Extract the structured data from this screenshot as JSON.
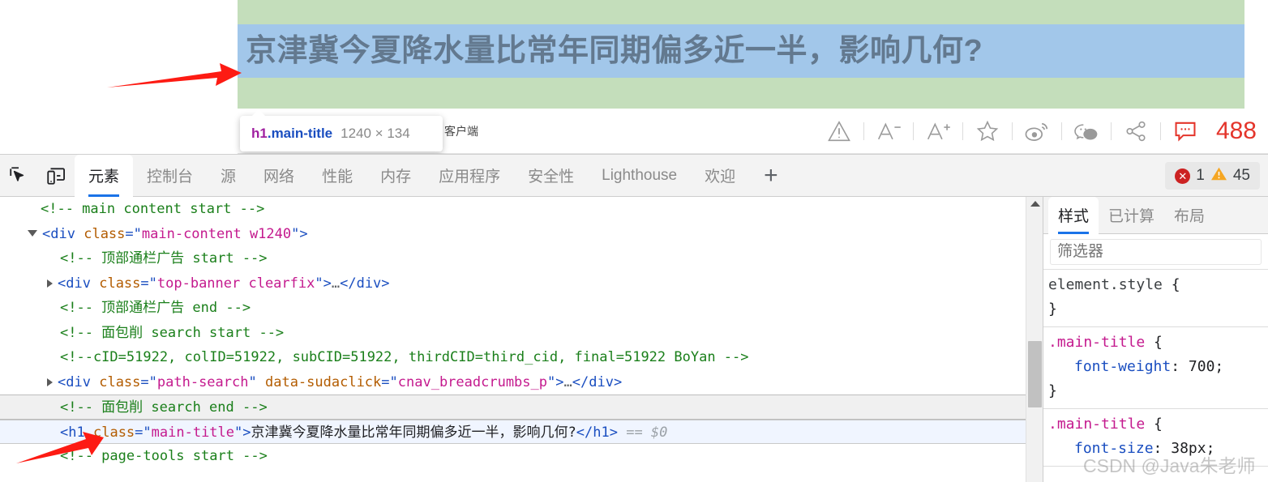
{
  "page": {
    "highlighted_title": "京津冀今夏降水量比常年同期偏多近一半，影响几何?",
    "toolbar_label": "客户端",
    "comment_count": "488",
    "icons": [
      "warning-triangle-icon",
      "font-decrease-icon",
      "font-increase-icon",
      "star-icon",
      "weibo-icon",
      "wechat-icon",
      "share-icon",
      "comment-icon"
    ]
  },
  "inspector_tooltip": {
    "tag": "h1",
    "class": ".main-title",
    "dimensions": "1240 × 134"
  },
  "devtools": {
    "tabs": [
      {
        "label": "元素",
        "active": true
      },
      {
        "label": "控制台",
        "active": false
      },
      {
        "label": "源",
        "active": false
      },
      {
        "label": "网络",
        "active": false
      },
      {
        "label": "性能",
        "active": false
      },
      {
        "label": "内存",
        "active": false
      },
      {
        "label": "应用程序",
        "active": false
      },
      {
        "label": "安全性",
        "active": false
      },
      {
        "label": "Lighthouse",
        "active": false
      },
      {
        "label": "欢迎",
        "active": false
      }
    ],
    "add_tab_label": "+",
    "error_count": "1",
    "warning_count": "45",
    "error_badge_glyph": "✕"
  },
  "dom_tree": {
    "lines": [
      {
        "type": "comment",
        "text": "<!-- main content start -->"
      },
      {
        "type": "open_tag",
        "tag": "div",
        "attr": "class",
        "value": "main-content w1240",
        "twisty": "open"
      },
      {
        "type": "comment",
        "text": "<!-- 顶部通栏广告 start -->"
      },
      {
        "type": "collapsed_tag",
        "tag": "div",
        "attr": "class",
        "value": "top-banner clearfix",
        "twisty": "closed"
      },
      {
        "type": "comment",
        "text": "<!-- 顶部通栏广告 end -->"
      },
      {
        "type": "comment",
        "text": "<!-- 面包削 search start -->"
      },
      {
        "type": "comment",
        "text": "<!--cID=51922, colID=51922, subCID=51922, thirdCID=third_cid, final=51922 BoYan -->"
      },
      {
        "type": "collapsed_tag",
        "tag": "div",
        "attr": "class",
        "value": "path-search",
        "attr2": "data-sudaclick",
        "value2": "cnav_breadcrumbs_p",
        "twisty": "closed"
      },
      {
        "type": "comment",
        "text": "<!-- 面包削 search end -->",
        "hovered": true
      },
      {
        "type": "selected_h1",
        "tag": "h1",
        "attr": "class",
        "value": "main-title",
        "text": "京津冀今夏降水量比常年同期偏多近一半，影响几何?",
        "suffix": "== $0"
      },
      {
        "type": "comment",
        "text": "<!-- page-tools start -->"
      }
    ],
    "ellipsis": "…"
  },
  "styles_panel": {
    "tabs": [
      {
        "label": "样式",
        "active": true
      },
      {
        "label": "已计算",
        "active": false
      },
      {
        "label": "布局",
        "active": false
      }
    ],
    "filter_placeholder": "筛选器",
    "rules": [
      {
        "selector": "element.style",
        "declarations": []
      },
      {
        "selector": ".main-title",
        "declarations": [
          {
            "prop": "font-weight",
            "value": "700;"
          }
        ]
      },
      {
        "selector": ".main-title",
        "declarations": [
          {
            "prop": "font-size",
            "value": "38px;"
          }
        ]
      }
    ]
  },
  "watermark": "CSDN @Java朱老师",
  "colors": {
    "highlight_padding": "#c4debb",
    "highlight_content": "#a2c7ea",
    "title_text": "#63798f",
    "accent_blue": "#1a73e8",
    "error_red": "#cc2222",
    "warning_yellow": "#f5a623",
    "comment_red": "#e4352b",
    "annotation_arrow": "#fd1b13"
  }
}
